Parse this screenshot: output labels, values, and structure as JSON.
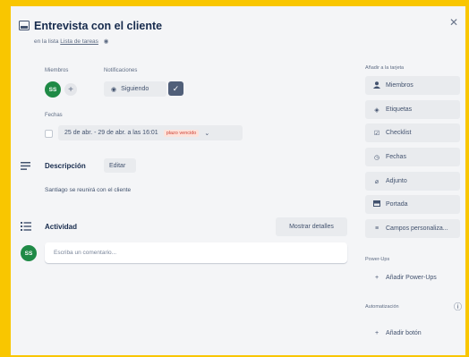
{
  "header": {
    "title": "Entrevista con el cliente",
    "subtitle_prefix": "en la lista",
    "list_link": "Lista de tareas"
  },
  "members": {
    "label": "Miembros",
    "avatar_initials": "SS",
    "add_symbol": "+"
  },
  "notifications": {
    "label": "Notificaciones",
    "button_label": "Siguiendo"
  },
  "dates": {
    "label": "Fechas",
    "range": "25 de abr. - 29 de abr. a las 16:01",
    "badge": "plazo vencido"
  },
  "description": {
    "title": "Descripción",
    "edit_label": "Editar",
    "text": "Santiago se reunirá con el cliente"
  },
  "activity": {
    "title": "Actividad",
    "show_details_label": "Mostrar detalles",
    "avatar_initials": "SS",
    "comment_placeholder": "Escriba un comentario..."
  },
  "sidebar": {
    "add_to_card_label": "Añadir a la tarjeta",
    "items": [
      {
        "icon": "person-icon",
        "glyph": "👤",
        "label": "Miembros"
      },
      {
        "icon": "tag-icon",
        "glyph": "◈",
        "label": "Etiquetas"
      },
      {
        "icon": "checklist-icon",
        "glyph": "☑",
        "label": "Checklist"
      },
      {
        "icon": "clock-icon",
        "glyph": "◷",
        "label": "Fechas"
      },
      {
        "icon": "paperclip-icon",
        "glyph": "⌀",
        "label": "Adjunto"
      },
      {
        "icon": "cover-icon",
        "glyph": "▬",
        "label": "Portada"
      },
      {
        "icon": "custom-fields-icon",
        "glyph": "≡",
        "label": "Campos personaliza..."
      }
    ],
    "powerups_label": "Power-Ups",
    "add_powerups_label": "Añadir Power-Ups",
    "automation_label": "Automatización",
    "add_button_label": "Añadir botón"
  },
  "colors": {
    "frame": "#f9c600",
    "avatar": "#1f8a46",
    "badge_text": "#d04437"
  }
}
